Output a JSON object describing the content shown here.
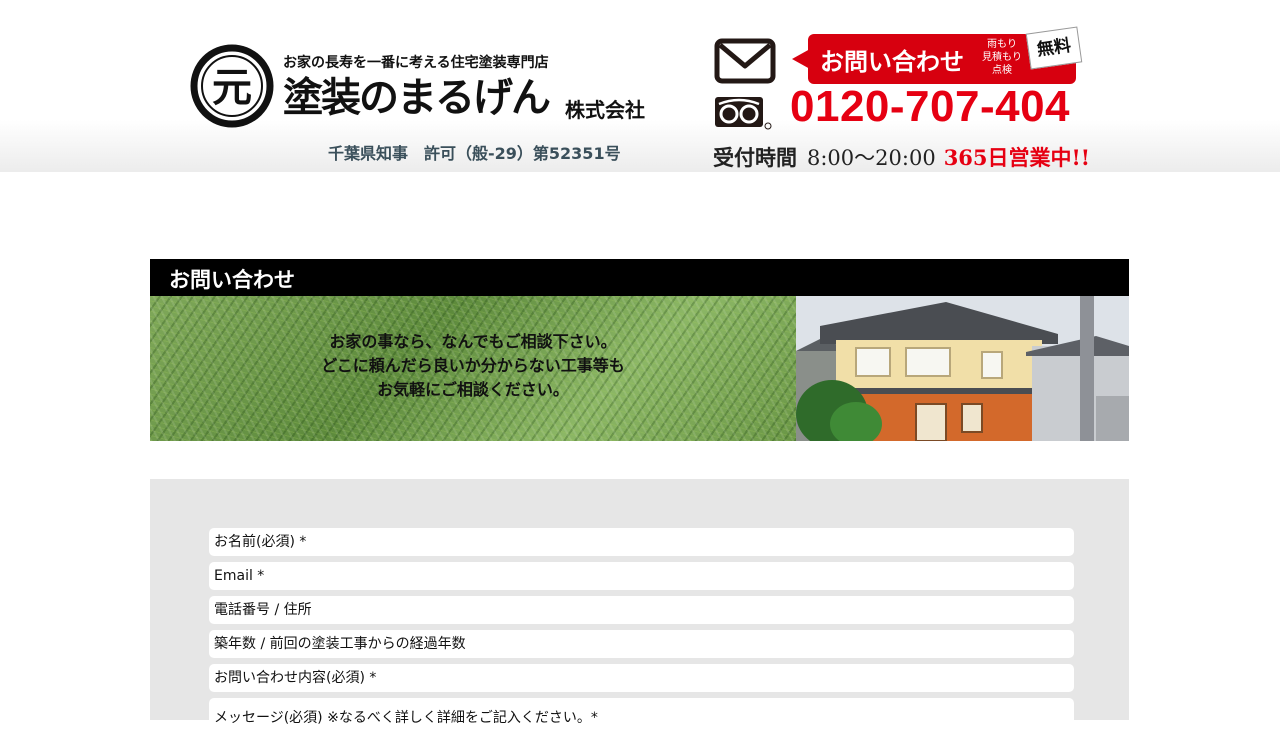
{
  "header": {
    "tagline": "お家の長寿を一番に考える住宅塗装専門店",
    "company_name": "塗装のまるげん",
    "company_suffix": "株式会社",
    "logo_glyph": "元",
    "license": "千葉県知事　許可（般-29）第52351号",
    "contact_badge": {
      "label": "お問い合わせ",
      "note_line1": "雨もり",
      "note_line2": "見積もり",
      "note_line3": "点検",
      "free": "無料"
    },
    "phone": "0120-707-404",
    "hours_label": "受付時間",
    "hours_time": "8:00〜20:00",
    "hours_days": "365日営業中!!",
    "icons": {
      "mail": "mail-icon",
      "freedial": "freedial-icon"
    },
    "colors": {
      "accent_red": "#e60012",
      "badge_red": "#d7000f",
      "license_text": "#3a4f5a"
    }
  },
  "contact_section": {
    "title": "お問い合わせ",
    "banner_lines": [
      "お家の事なら、なんでもご相談下さい。",
      "どこに頼んだら良いか分からない工事等も",
      "お気軽にご相談ください。"
    ]
  },
  "form": {
    "fields": [
      {
        "placeholder": "お名前(必須) *"
      },
      {
        "placeholder": "Email *"
      },
      {
        "placeholder": "電話番号 / 住所"
      },
      {
        "placeholder": "築年数 / 前回の塗装工事からの経過年数"
      },
      {
        "placeholder": "お問い合わせ内容(必須) *"
      },
      {
        "placeholder": "メッセージ(必須) ※なるべく詳しく詳細をご記入ください。*"
      }
    ]
  }
}
